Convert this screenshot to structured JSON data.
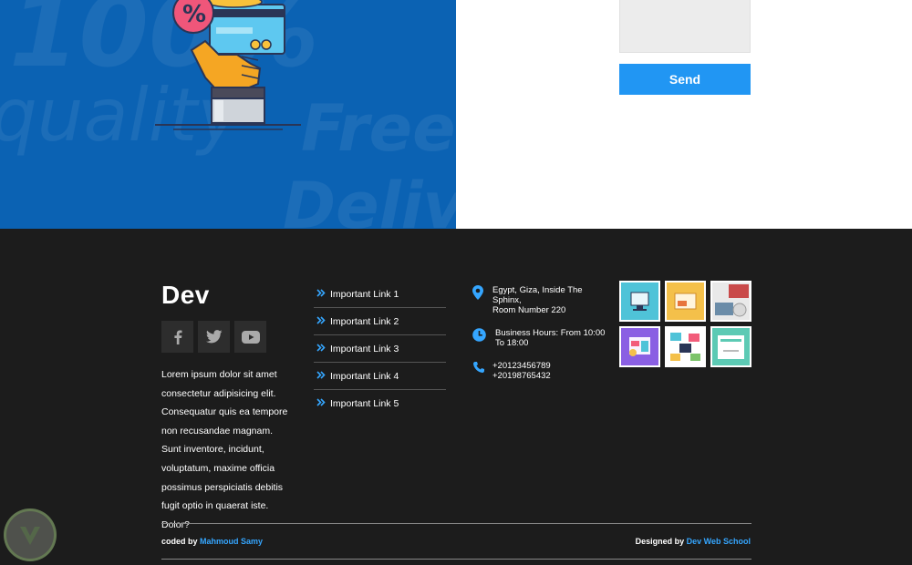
{
  "contact": {
    "send_label": "Send"
  },
  "footer": {
    "brand": "Dev",
    "social": [
      {
        "icon": "facebook-icon"
      },
      {
        "icon": "twitter-icon"
      },
      {
        "icon": "youtube-icon"
      }
    ],
    "about": "Lorem ipsum dolor sit amet consectetur adipisicing elit. Consequatur quis ea tempore non recusandae magnam. Sunt inventore, incidunt, voluptatum, maxime officia possimus perspiciatis debitis fugit optio in quaerat iste. Dolor?",
    "links": [
      {
        "label": "Important Link 1"
      },
      {
        "label": "Important Link 2"
      },
      {
        "label": "Important Link 3"
      },
      {
        "label": "Important Link 4"
      },
      {
        "label": "Important Link 5"
      }
    ],
    "address_line1": "Egypt, Giza, Inside The Sphinx,",
    "address_line2": "Room Number 220",
    "hours_line1": "Business Hours: From 10:00",
    "hours_line2": "To 18:00",
    "phone1": "+20123456789",
    "phone2": "+20198765432",
    "credit_left_prefix": "coded by ",
    "credit_left_name": "Mahmoud Samy",
    "credit_right_prefix": "Designed by ",
    "credit_right_name": "Dev Web School"
  },
  "colors": {
    "hero_blue": "#0b62b3",
    "accent": "#35a6ff",
    "send_button": "#2196f3",
    "footer_bg": "#1c1c1c"
  }
}
